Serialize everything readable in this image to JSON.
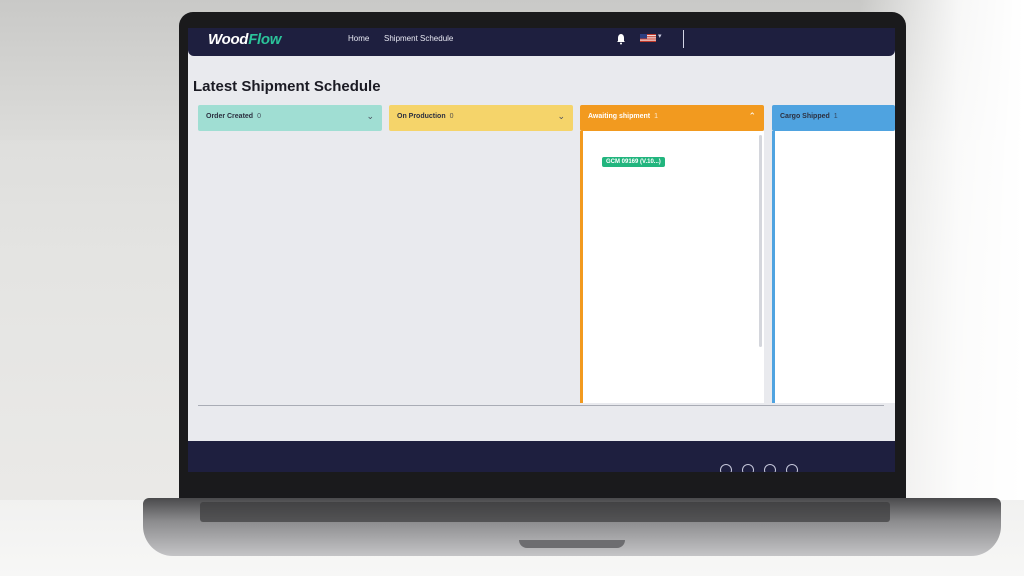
{
  "header": {
    "logo_part1": "Wood",
    "logo_part2": "Flow",
    "nav": [
      {
        "label": "Home"
      },
      {
        "label": "Shipment Schedule"
      }
    ],
    "accent_color": "#2bc39a",
    "nav_bg": "#1e1f3f"
  },
  "page": {
    "title": "Latest Shipment Schedule"
  },
  "columns": [
    {
      "label": "Order Created",
      "count": "0",
      "color": "#a0ded3",
      "chevron": "⌄"
    },
    {
      "label": "On Production",
      "count": "0",
      "color": "#f5d46a",
      "chevron": "⌄"
    },
    {
      "label": "Awaiting shipment",
      "count": "1",
      "color": "#f29a1f",
      "chevron": "⌃"
    },
    {
      "label": "Cargo Shipped",
      "count": "1",
      "color": "#4fa3e0",
      "chevron": ""
    }
  ],
  "cards": {
    "awaiting": {
      "badge": "GCM 09169 (V.10...)"
    }
  },
  "icons": {
    "bell": "bell-icon",
    "flag": "us-flag-icon",
    "social": [
      "facebook-icon",
      "twitter-icon",
      "instagram-icon",
      "linkedin-icon"
    ]
  }
}
